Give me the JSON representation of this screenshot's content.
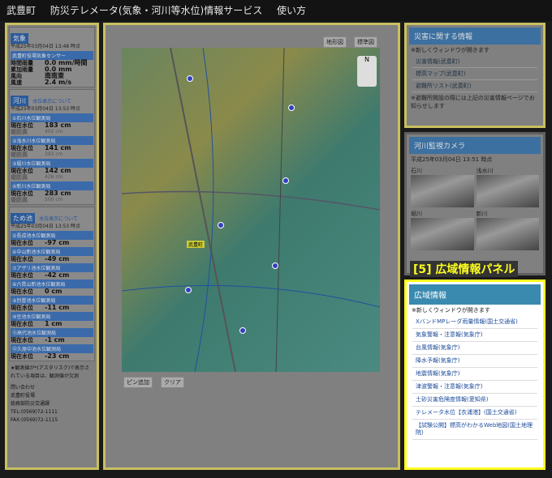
{
  "header": {
    "town": "武豊町",
    "title": "防災テレメータ(気象・河川等水位)情報サービス",
    "usage": "使い方"
  },
  "weather": {
    "heading": "気象",
    "time": "平成25年03月04日 13:48 時点",
    "station": "武豊町役場気象センサー",
    "rows": [
      [
        "時間雨量",
        "0.0 mm/時間"
      ],
      [
        "累加雨量",
        "0.0 mm"
      ],
      [
        "風向",
        "南南東"
      ],
      [
        "風速",
        "2.4 m/s"
      ]
    ]
  },
  "river": {
    "heading": "河川",
    "link": "水位表示について",
    "time": "平成25年03月04日 13:53 時点",
    "stations": [
      {
        "name": "①石川水位観測局",
        "now": "183 cm",
        "levee": "402 cm"
      },
      {
        "name": "②浅水川水位観測局",
        "now": "141 cm",
        "levee": "393 cm"
      },
      {
        "name": "③堀川水位観測局",
        "now": "142 cm",
        "levee": "426 cm"
      },
      {
        "name": "④新川水位観測局",
        "now": "283 cm",
        "levee": "500 cm"
      }
    ]
  },
  "pond": {
    "heading": "ため池",
    "link": "水位表示について",
    "time": "平成25年03月04日 13:53 時点",
    "stations": [
      {
        "name": "⑤長成池水位観測局",
        "now": "-97 cm"
      },
      {
        "name": "⑥中山新池水位観測局",
        "now": "-49 cm"
      },
      {
        "name": "⑦アザリ池水位観測局",
        "now": "-42 cm"
      },
      {
        "name": "⑧六貫山新池水位観測局",
        "now": "0 cm"
      },
      {
        "name": "⑨別曽池水位観測局",
        "now": "-11 cm"
      },
      {
        "name": "⑩豆池水位観測局",
        "now": "1 cm"
      },
      {
        "name": "⑪高代池水位観測局",
        "now": "-1 cm"
      },
      {
        "name": "⑫久原中池水位観測局",
        "now": "-23 cm"
      }
    ]
  },
  "labels": {
    "now": "現在水位",
    "levee": "堤防高"
  },
  "footer": {
    "note": "★観測値が*(アスタリスク)で表示されている項目は、観測値が欠測",
    "contact": [
      "問い合わせ",
      "武豊町役場",
      "総務部防災交通課",
      "TEL:(0569)72-1111",
      "FAX:(0569)72-1115"
    ]
  },
  "map": {
    "btn_terrain": "地形図",
    "btn_standard": "標準図",
    "pin_add": "ピン追加",
    "clear": "クリア",
    "station_label": "武豊町"
  },
  "disaster": {
    "heading": "災害に関する情報",
    "note": "※新しくウィンドウが開きます",
    "links": [
      "災害情報(武豊町)",
      "標高マップ(武豊町)",
      "避難所リスト(武豊町)"
    ],
    "foot": "※避難所開設の際には上記の災害情報ページでお知らせします"
  },
  "camera": {
    "heading": "河川監視カメラ",
    "time": "平成25年03月04日 13:51 時点",
    "cams": [
      "石川",
      "浅水川",
      "堀川",
      "新川"
    ]
  },
  "wide": {
    "badge": "[5] 広域情報パネル",
    "heading": "広域情報",
    "note": "※新しくウィンドウが開きます",
    "links": [
      "XバンドMPレーダ雨量情報(国土交通省)",
      "気象警報・注意報(気象庁)",
      "台風情報(気象庁)",
      "降水予報(気象庁)",
      "地震情報(気象庁)",
      "津波警報・注意報(気象庁)",
      "土砂災害危険度情報(愛知県)",
      "テレメータ水位【衣浦港】(国土交通省)",
      "【試験公開】標高がわかるWeb地図(国土地理院)"
    ]
  }
}
